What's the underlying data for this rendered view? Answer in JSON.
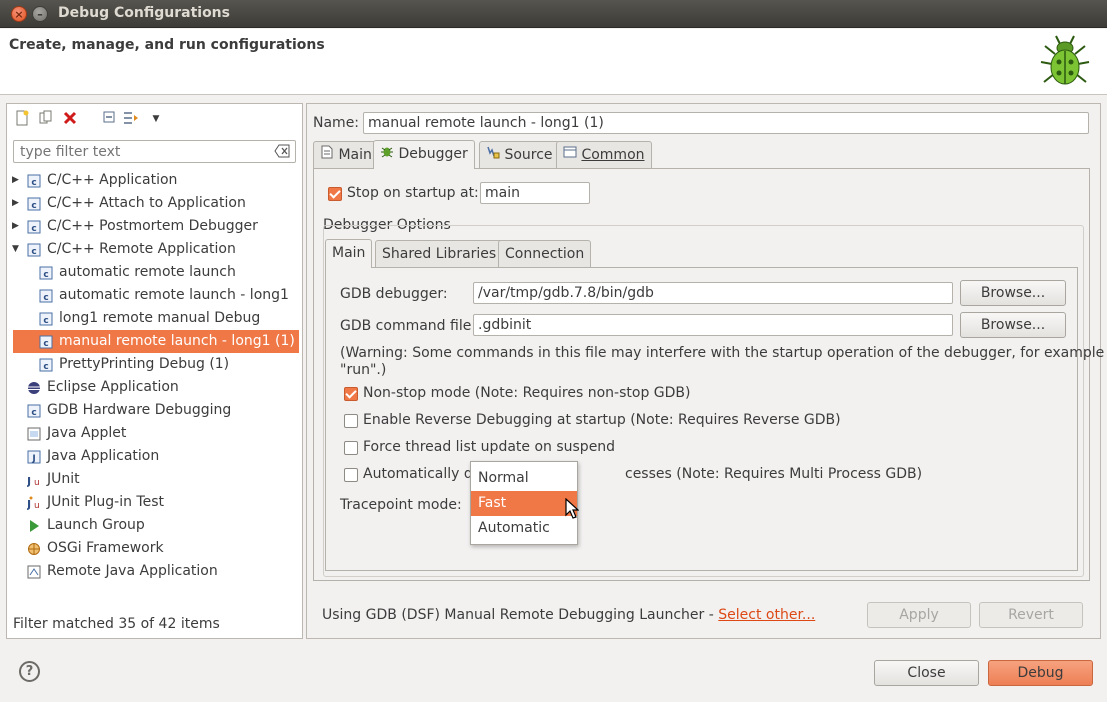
{
  "window": {
    "title": "Debug Configurations"
  },
  "header": {
    "subtitle": "Create, manage, and run configurations"
  },
  "left": {
    "filter_placeholder": "type filter text",
    "tree": [
      {
        "label": "C/C++ Application",
        "level": 0,
        "expander": "collapsed",
        "icon": "c-config-icon"
      },
      {
        "label": "C/C++ Attach to Application",
        "level": 0,
        "expander": "collapsed",
        "icon": "c-config-icon"
      },
      {
        "label": "C/C++ Postmortem Debugger",
        "level": 0,
        "expander": "collapsed",
        "icon": "c-config-icon"
      },
      {
        "label": "C/C++ Remote Application",
        "level": 0,
        "expander": "expanded",
        "icon": "c-config-icon"
      },
      {
        "label": "automatic remote launch",
        "level": 1,
        "icon": "c-config-icon"
      },
      {
        "label": "automatic remote launch - long1",
        "level": 1,
        "icon": "c-config-icon"
      },
      {
        "label": "long1 remote manual Debug",
        "level": 1,
        "icon": "c-config-icon"
      },
      {
        "label": "manual remote launch - long1 (1)",
        "level": 1,
        "icon": "c-config-icon",
        "selected": true
      },
      {
        "label": "PrettyPrinting Debug (1)",
        "level": 1,
        "icon": "c-config-icon"
      },
      {
        "label": "Eclipse Application",
        "level": 0,
        "icon": "eclipse-icon"
      },
      {
        "label": "GDB Hardware Debugging",
        "level": 0,
        "icon": "c-config-icon"
      },
      {
        "label": "Java Applet",
        "level": 0,
        "icon": "applet-icon"
      },
      {
        "label": "Java Application",
        "level": 0,
        "icon": "java-icon"
      },
      {
        "label": "JUnit",
        "level": 0,
        "icon": "junit-icon"
      },
      {
        "label": "JUnit Plug-in Test",
        "level": 0,
        "icon": "junit-plugin-icon"
      },
      {
        "label": "Launch Group",
        "level": 0,
        "icon": "launch-group-icon"
      },
      {
        "label": "OSGi Framework",
        "level": 0,
        "icon": "osgi-icon"
      },
      {
        "label": "Remote Java Application",
        "level": 0,
        "icon": "remote-java-icon"
      }
    ],
    "status": "Filter matched 35 of 42 items"
  },
  "right": {
    "name_label": "Name:",
    "name_value": "manual remote launch - long1 (1)",
    "tabs": [
      "Main",
      "Debugger",
      "Source",
      "Common"
    ],
    "active_tab": "Debugger",
    "stop_on_startup_label": "Stop on startup at:",
    "stop_on_startup_checked": true,
    "stop_on_startup_value": "main",
    "debugger_options_label": "Debugger Options",
    "subtabs": [
      "Main",
      "Shared Libraries",
      "Connection"
    ],
    "active_subtab": "Main",
    "gdb_debugger_label": "GDB debugger:",
    "gdb_debugger_value": "/var/tmp/gdb.7.8/bin/gdb",
    "gdb_command_label": "GDB command file:",
    "gdb_command_value": ".gdbinit",
    "browse_label": "Browse...",
    "warning": "(Warning: Some commands in this file may interfere with the startup operation of the debugger, for example",
    "warning2": "\"run\".)",
    "options": [
      {
        "label": "Non-stop mode (Note: Requires non-stop GDB)",
        "checked": true
      },
      {
        "label": "Enable Reverse Debugging at startup (Note: Requires Reverse GDB)",
        "checked": false
      },
      {
        "label": "Force thread list update on suspend",
        "checked": false
      },
      {
        "label": "Automatically debug forked processes (Note: Requires Multi Process GDB)",
        "checked": false
      }
    ],
    "auto_debug_visible_start": "Automatically de",
    "auto_debug_visible_end": "cesses (Note: Requires Multi Process GDB)",
    "tracepoint_label": "Tracepoint mode:",
    "tracepoint_options": [
      "Normal",
      "Fast",
      "Automatic"
    ],
    "tracepoint_highlighted": "Fast",
    "launcher_text": "Using GDB (DSF) Manual Remote Debugging Launcher - ",
    "select_other": "Select other...",
    "apply": "Apply",
    "revert": "Revert"
  },
  "footer": {
    "close": "Close",
    "debug": "Debug",
    "help": "?"
  },
  "colors": {
    "accent": "#f07746",
    "link": "#dd4814"
  }
}
